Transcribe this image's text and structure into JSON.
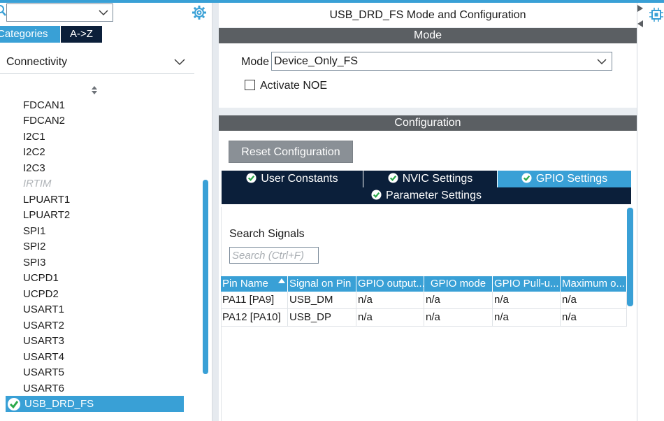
{
  "app": {
    "accent_color": "#39a0d6",
    "dark_color": "#0b1f3a",
    "section_color": "#5b5f63"
  },
  "left_panel": {
    "search": {
      "value": "",
      "icon": "search-icon"
    },
    "tabs": {
      "categories": "Categories",
      "az": "A->Z"
    },
    "category": "Connectivity",
    "items": [
      {
        "label": "FDCAN1",
        "disabled": false
      },
      {
        "label": "FDCAN2",
        "disabled": false
      },
      {
        "label": "I2C1",
        "disabled": false
      },
      {
        "label": "I2C2",
        "disabled": false
      },
      {
        "label": "I2C3",
        "disabled": false
      },
      {
        "label": "IRTIM",
        "disabled": true
      },
      {
        "label": "LPUART1",
        "disabled": false
      },
      {
        "label": "LPUART2",
        "disabled": false
      },
      {
        "label": "SPI1",
        "disabled": false
      },
      {
        "label": "SPI2",
        "disabled": false
      },
      {
        "label": "SPI3",
        "disabled": false
      },
      {
        "label": "UCPD1",
        "disabled": false
      },
      {
        "label": "UCPD2",
        "disabled": false
      },
      {
        "label": "USART1",
        "disabled": false
      },
      {
        "label": "USART2",
        "disabled": false
      },
      {
        "label": "USART3",
        "disabled": false
      },
      {
        "label": "USART4",
        "disabled": false
      },
      {
        "label": "USART5",
        "disabled": false
      },
      {
        "label": "USART6",
        "disabled": false
      }
    ],
    "selected_item": "USB_DRD_FS"
  },
  "right_panel": {
    "title": "USB_DRD_FS Mode and Configuration",
    "mode_section": {
      "header": "Mode",
      "mode_label": "Mode",
      "mode_value": "Device_Only_FS",
      "activate_noe_label": "Activate NOE",
      "activate_noe_checked": false
    },
    "config_section": {
      "header": "Configuration",
      "reset_button": "Reset Configuration",
      "tabs": [
        {
          "label": "User Constants",
          "active": false
        },
        {
          "label": "NVIC Settings",
          "active": false
        },
        {
          "label": "GPIO Settings",
          "active": true
        },
        {
          "label": "Parameter Settings",
          "active": false
        }
      ],
      "search_signals_label": "Search Signals",
      "search_placeholder": "Search (Ctrl+F)",
      "table": {
        "columns": [
          "Pin Name",
          "Signal on Pin",
          "GPIO output...",
          "GPIO mode",
          "GPIO Pull-u...",
          "Maximum o..."
        ],
        "rows": [
          [
            "PA11 [PA9]",
            "USB_DM",
            "n/a",
            "n/a",
            "n/a",
            "n/a"
          ],
          [
            "PA12 [PA10]",
            "USB_DP",
            "n/a",
            "n/a",
            "n/a",
            "n/a"
          ]
        ]
      }
    }
  }
}
